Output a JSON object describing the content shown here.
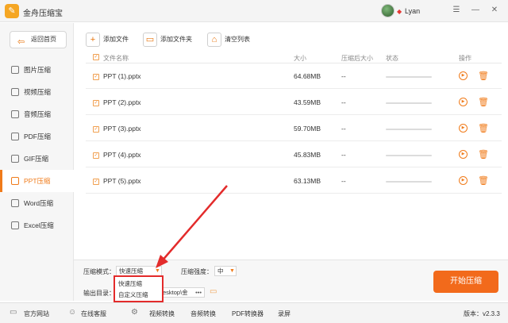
{
  "app": {
    "logo_glyph": "✎",
    "title": "金舟压缩宝",
    "user_name": "Lyan",
    "vip_glyph": "◆"
  },
  "window_controls": {
    "menu": "☰",
    "minimize": "—",
    "close": "✕"
  },
  "sidebar": {
    "back_label": "返回首页",
    "items": [
      {
        "label": "图片压缩",
        "active": false
      },
      {
        "label": "视频压缩",
        "active": false
      },
      {
        "label": "音频压缩",
        "active": false
      },
      {
        "label": "PDF压缩",
        "active": false
      },
      {
        "label": "GIF压缩",
        "active": false
      },
      {
        "label": "PPT压缩",
        "active": true
      },
      {
        "label": "Word压缩",
        "active": false
      },
      {
        "label": "Excel压缩",
        "active": false
      }
    ]
  },
  "toolbar": {
    "add_file": "添加文件",
    "add_folder": "添加文件夹",
    "clear_list": "清空列表"
  },
  "table": {
    "headers": {
      "name": "文件名称",
      "size": "大小",
      "after": "压缩后大小",
      "status": "状态",
      "action": "操作"
    },
    "rows": [
      {
        "name": "PPT (1).pptx",
        "size": "64.68MB",
        "after": "--"
      },
      {
        "name": "PPT (2).pptx",
        "size": "43.59MB",
        "after": "--"
      },
      {
        "name": "PPT (3).pptx",
        "size": "59.70MB",
        "after": "--"
      },
      {
        "name": "PPT (4).pptx",
        "size": "45.83MB",
        "after": "--"
      },
      {
        "name": "PPT (5).pptx",
        "size": "63.13MB",
        "after": "--"
      }
    ]
  },
  "settings": {
    "mode_label": "压缩模式：",
    "mode_value": "快速压缩",
    "mode_options": [
      "快速压缩",
      "自定义压缩"
    ],
    "strength_label": "压缩强度：",
    "strength_value": "中",
    "output_label": "输出目录：",
    "output_path_visible": "esktop\\金",
    "more_glyph": "•••",
    "start_button": "开始压缩"
  },
  "footer": {
    "items": [
      "官方网站",
      "在线客服",
      "视频转换",
      "音频转换",
      "PDF转换器",
      "录屏"
    ],
    "version": "版本：v2.3.3"
  },
  "colors": {
    "accent": "#f07b1a",
    "start_button": "#f26a1b",
    "annotation_red": "#e32b2b"
  }
}
